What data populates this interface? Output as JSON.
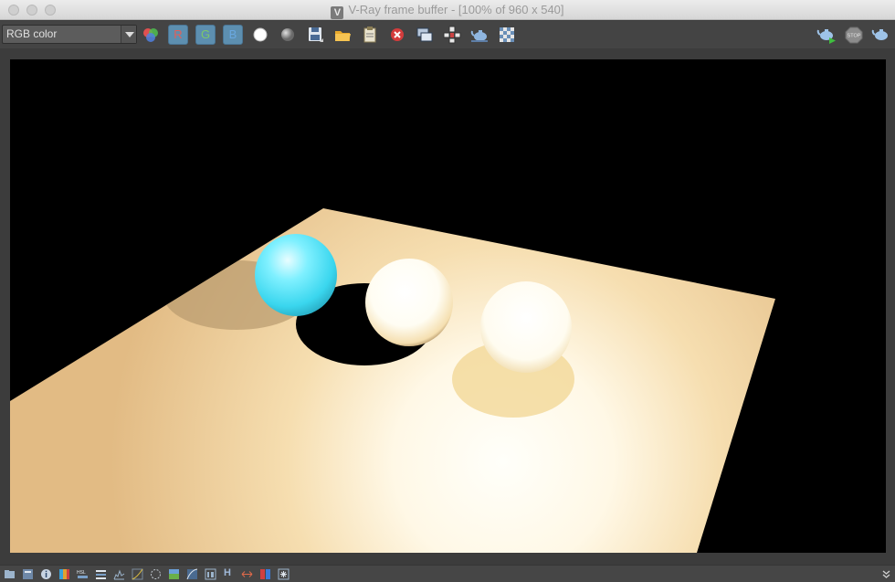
{
  "window": {
    "title": "V-Ray frame buffer - [100% of 960 x 540]",
    "app_logo": "vray-logo-icon"
  },
  "toolbar": {
    "channel_select": "RGB color",
    "channel_buttons": [
      "R",
      "G",
      "B"
    ],
    "icons": [
      "color-correction-icon",
      "white-point-icon",
      "gray-point-icon",
      "save-image-icon",
      "load-image-icon",
      "copy-to-clipboard-icon",
      "clear-image-icon",
      "duplicate-to-history-icon",
      "track-mouse-icon",
      "region-render-icon",
      "checker-icon",
      "render-icon",
      "stop-icon",
      "render-last-icon"
    ],
    "stop_label": "STOP"
  },
  "statusbar": {
    "h_label": "H",
    "icons": [
      "history-icon",
      "layers-icon",
      "info-icon",
      "lut-icon",
      "hsl-icon",
      "levels-icon",
      "histogram-icon",
      "curves-icon",
      "exposure-icon",
      "background-image-icon",
      "white-balance-icon",
      "show-stats-icon",
      "hue-icon",
      "compare-icon",
      "color-balance-icon",
      "lens-effects-icon",
      "expand-icon"
    ]
  },
  "colors": {
    "chrome_bg": "#3c3c3c",
    "toolbar_bg": "#444444",
    "channel_button": "#5d8fb0",
    "plane": "#e9c48f",
    "sphere_cyan": "#5fe3f5"
  }
}
